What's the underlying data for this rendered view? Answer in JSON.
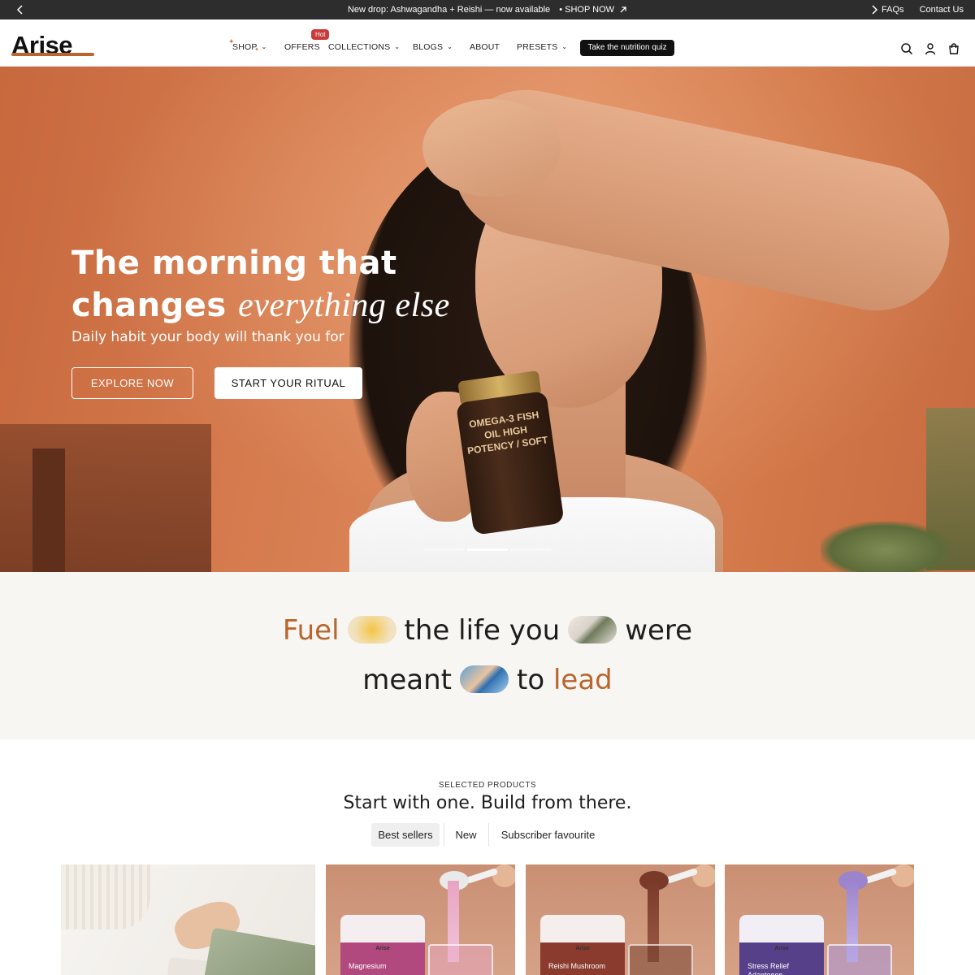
{
  "announcement": {
    "message": "New drop: Ashwagandha + Reishi — now available",
    "cta": "SHOP NOW",
    "links": [
      "FAQs",
      "Contact Us"
    ]
  },
  "header": {
    "logo": "Arise",
    "nav": {
      "shop": "SHOP",
      "offers": "OFFERS",
      "hot_badge": "Hot",
      "collections": "COLLECTIONS",
      "blogs": "BLOGS",
      "about": "ABOUT",
      "presets": "PRESETS"
    },
    "quiz_button": "Take the nutrition quiz",
    "icons": [
      "search-icon",
      "account-icon",
      "cart-icon"
    ]
  },
  "hero": {
    "title_line1": "The morning that",
    "title_line2_plain": "changes",
    "title_line2_italic": "everything else",
    "subtitle": "Daily habit your body will thank you for",
    "explore_button": "EXPLORE NOW",
    "ritual_button": "START YOUR RITUAL",
    "jar_label": "OMEGA-3 FISH OIL HIGH POTENCY / SOFT",
    "slides": 3,
    "active_slide": 2
  },
  "manifesto": {
    "line1": {
      "w1": "Fuel",
      "w2": "the life you",
      "w3": "were"
    },
    "line2": {
      "w1": "meant",
      "w2": "to",
      "w3": "lead"
    }
  },
  "products_section": {
    "label": "SELECTED PRODUCTS",
    "title": "Start with one. Build from there.",
    "tabs": [
      "Best sellers",
      "New",
      "Subscriber favourite"
    ],
    "active_tab": "Best sellers",
    "cards": [
      {
        "brand": "",
        "name": ""
      },
      {
        "brand": "Arise",
        "name": "Magnesium",
        "color": "#b2497e"
      },
      {
        "brand": "Arise",
        "name": "Reishi Mushroom",
        "color": "#8a3b2d"
      },
      {
        "brand": "Arise",
        "name": "Stress Relief Adaptogen",
        "color": "#56408a"
      }
    ]
  },
  "colors": {
    "accent": "#b8652e",
    "announcement_bg": "#2d2d2d",
    "manifesto_bg": "#f8f6f2"
  }
}
